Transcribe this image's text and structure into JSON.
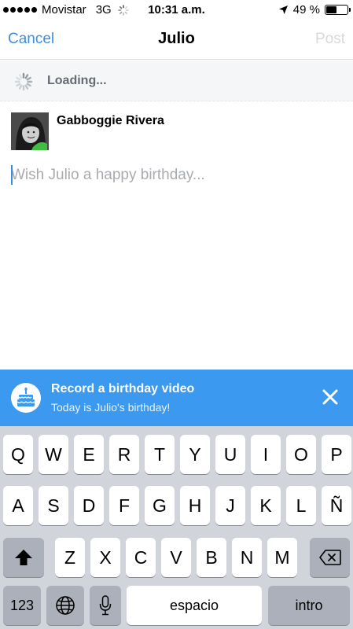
{
  "status_bar": {
    "carrier": "Movistar",
    "network": "3G",
    "time": "10:31 a.m.",
    "battery_percent": "49 %",
    "battery_level": 0.49
  },
  "nav": {
    "cancel_label": "Cancel",
    "title": "Julio",
    "post_label": "Post"
  },
  "loading": {
    "text": "Loading..."
  },
  "composer": {
    "user_name": "Gabboggie Rivera",
    "placeholder": "Wish Julio a happy birthday..."
  },
  "birthday_banner": {
    "title": "Record a birthday video",
    "subtitle": "Today is Julio's birthday!"
  },
  "keyboard": {
    "row1": [
      "Q",
      "W",
      "E",
      "R",
      "T",
      "Y",
      "U",
      "I",
      "O",
      "P"
    ],
    "row2": [
      "A",
      "S",
      "D",
      "F",
      "G",
      "H",
      "J",
      "K",
      "L",
      "Ñ"
    ],
    "row3": [
      "Z",
      "X",
      "C",
      "V",
      "B",
      "N",
      "M"
    ],
    "numbers_label": "123",
    "space_label": "espacio",
    "return_label": "intro"
  },
  "colors": {
    "accent": "#3b8ee0",
    "banner": "#3b99f0",
    "post_disabled": "#d6d9dd"
  },
  "icons": {
    "location": "location-arrow-icon",
    "shift": "shift-arrow-icon",
    "delete": "backspace-icon",
    "globe": "globe-icon",
    "mic": "microphone-icon",
    "cake": "birthday-cake-icon",
    "close": "close-icon"
  }
}
